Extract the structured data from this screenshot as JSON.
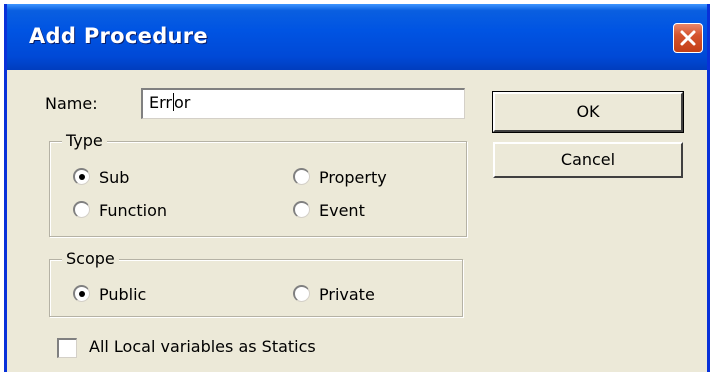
{
  "window": {
    "title": "Add Procedure",
    "close_label": "Close"
  },
  "name": {
    "label": "Name:",
    "value_before_caret": "Err",
    "value_after_caret": "or"
  },
  "type_group": {
    "legend": "Type",
    "options": [
      {
        "label": "Sub",
        "checked": true
      },
      {
        "label": "Property",
        "checked": false
      },
      {
        "label": "Function",
        "checked": false
      },
      {
        "label": "Event",
        "checked": false
      }
    ]
  },
  "scope_group": {
    "legend": "Scope",
    "options": [
      {
        "label": "Public",
        "checked": true
      },
      {
        "label": "Private",
        "checked": false
      }
    ]
  },
  "statics_checkbox": {
    "label": "All Local variables as Statics",
    "checked": false
  },
  "buttons": {
    "ok": "OK",
    "cancel": "Cancel"
  },
  "colors": {
    "titlebar": "#0054e3",
    "window_bg": "#ece9d8",
    "close_button": "#d5542e"
  },
  "icons": {
    "close": "close-icon"
  }
}
